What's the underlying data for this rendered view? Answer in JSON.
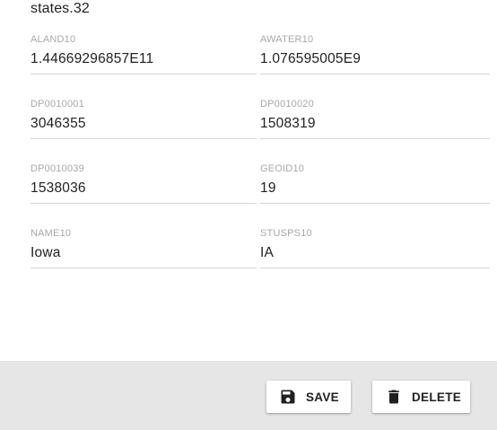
{
  "record": {
    "title": "states.32"
  },
  "fields": [
    {
      "label": "ALAND10",
      "value": "1.44669296857E11"
    },
    {
      "label": "AWATER10",
      "value": "1.076595005E9"
    },
    {
      "label": "DP0010001",
      "value": "3046355"
    },
    {
      "label": "DP0010020",
      "value": "1508319"
    },
    {
      "label": "DP0010039",
      "value": "1538036"
    },
    {
      "label": "GEOID10",
      "value": "19"
    },
    {
      "label": "NAME10",
      "value": "Iowa"
    },
    {
      "label": "STUSPS10",
      "value": "IA"
    }
  ],
  "actions": {
    "save_label": "SAVE",
    "save_icon": "save-icon",
    "delete_label": "DELETE",
    "delete_icon": "delete-icon"
  },
  "colors": {
    "footer_background": "#e6e6e6",
    "text_primary": "#212121",
    "label_text": "#a8a8a8",
    "divider": "#d6d6d6"
  }
}
